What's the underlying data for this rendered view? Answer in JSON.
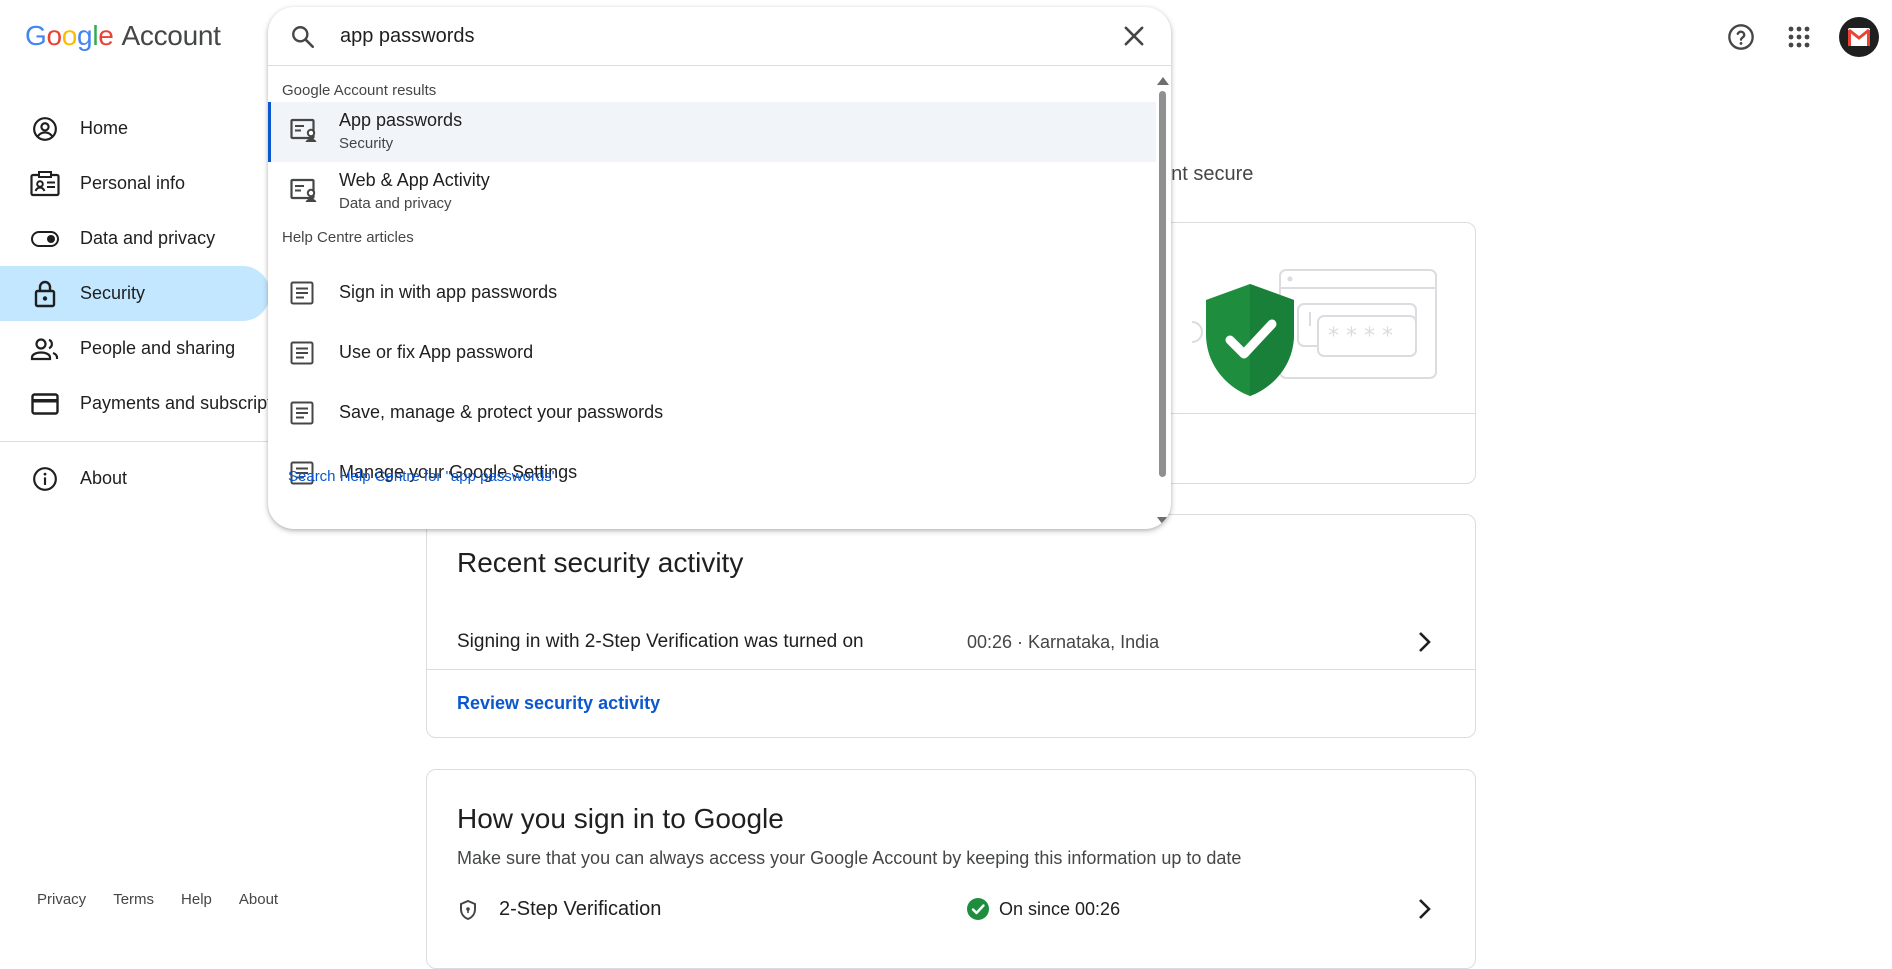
{
  "header": {
    "logo_letters": [
      "G",
      "o",
      "o",
      "g",
      "l",
      "e"
    ],
    "logo_suffix": "Account",
    "icons": [
      "help-icon",
      "apps-grid-icon",
      "gmail-avatar"
    ]
  },
  "sidebar": {
    "items": [
      {
        "label": "Home",
        "icon": "account-circle-icon"
      },
      {
        "label": "Personal info",
        "icon": "id-card-icon"
      },
      {
        "label": "Data and privacy",
        "icon": "toggle-icon"
      },
      {
        "label": "Security",
        "icon": "lock-icon",
        "active": true
      },
      {
        "label": "People and sharing",
        "icon": "people-icon"
      },
      {
        "label": "Payments and subscriptions",
        "icon": "credit-card-icon"
      },
      {
        "label": "About",
        "icon": "info-icon"
      }
    ]
  },
  "footer": {
    "links": [
      "Privacy",
      "Terms",
      "Help",
      "About"
    ]
  },
  "main": {
    "partial_heading": "unt secure",
    "recent_activity": {
      "title": "Recent security activity",
      "event": "Signing in with 2-Step Verification was turned on",
      "meta": "00:26 · Karnataka, India",
      "link": "Review security activity"
    },
    "sign_in": {
      "title": "How you sign in to Google",
      "description": "Make sure that you can always access your Google Account by keeping this information up to date",
      "row_name": "2-Step Verification",
      "row_status": "On since 00:26"
    }
  },
  "search": {
    "query": "app passwords",
    "account_section_label": "Google Account results",
    "account_results": [
      {
        "title": "App passwords",
        "subtitle": "Security"
      },
      {
        "title": "Web & App Activity",
        "subtitle": "Data and privacy"
      }
    ],
    "help_section_label": "Help Centre articles",
    "help_results": [
      {
        "title": "Sign in with app passwords"
      },
      {
        "title": "Use or fix App password"
      },
      {
        "title": "Save, manage & protect your passwords"
      },
      {
        "title": "Manage your Google Settings"
      }
    ],
    "more_link": "Search Help Centre for \"app passwords\""
  },
  "colors": {
    "accent": "#0b57d0",
    "active_nav": "#c2e7ff",
    "shield": "#1e8e3e",
    "status_ok": "#1e8e3e"
  }
}
